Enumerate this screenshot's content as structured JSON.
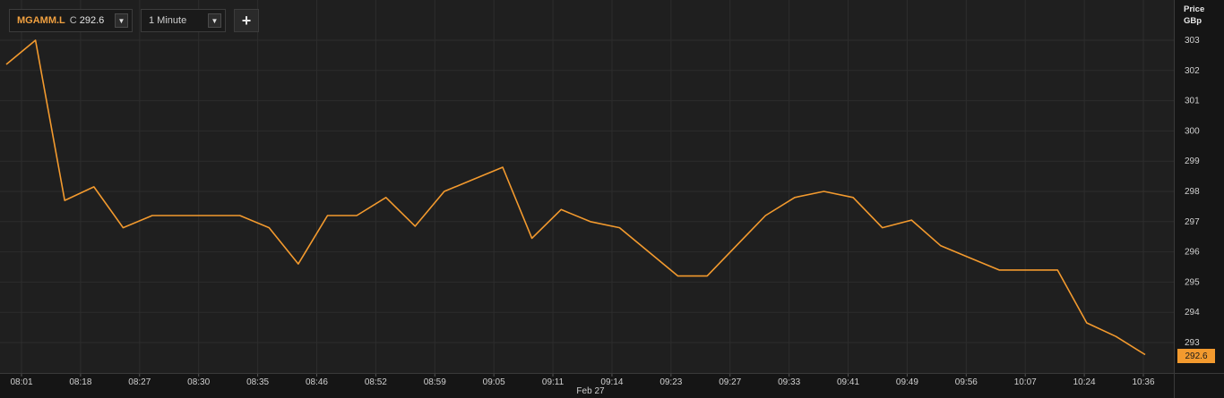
{
  "toolbar": {
    "symbol": "MGAMM.L",
    "close_prefix": "C",
    "close_value": "292.6",
    "symbol_dropdown_icon": "triangle-down-icon",
    "interval": "1 Minute",
    "interval_dropdown_icon": "triangle-down-icon",
    "add_label": "+"
  },
  "axis": {
    "price_title": "Price",
    "currency": "GBp",
    "last_price_tag": "292.6",
    "date_label": "Feb 27"
  },
  "colors": {
    "line": "#f39a2e",
    "grid": "#2d2d2d",
    "plot_bg": "#1f1f1f",
    "page_bg": "#151515",
    "accent": "#f0a040"
  },
  "chart_data": {
    "type": "line",
    "title": "",
    "xlabel": "Feb 27",
    "ylabel": "Price GBp",
    "ylim": [
      292.5,
      303.5
    ],
    "grid": true,
    "y_ticks": [
      293,
      294,
      295,
      296,
      297,
      298,
      299,
      300,
      301,
      302,
      303
    ],
    "x_tick_labels": [
      "08:01",
      "08:18",
      "08:27",
      "08:30",
      "08:35",
      "08:46",
      "08:52",
      "08:59",
      "09:05",
      "09:11",
      "09:14",
      "09:23",
      "09:27",
      "09:33",
      "09:41",
      "09:49",
      "09:56",
      "10:07",
      "10:24",
      "10:36"
    ],
    "series": [
      {
        "values": [
          302.2,
          303.0,
          297.7,
          298.15,
          296.8,
          297.2,
          297.2,
          297.2,
          297.2,
          296.8,
          295.6,
          297.2,
          297.2,
          297.8,
          296.85,
          298.0,
          298.4,
          298.8,
          296.45,
          297.4,
          297.0,
          296.8,
          296.0,
          295.2,
          295.2,
          296.2,
          297.2,
          297.8,
          298.0,
          297.8,
          296.8,
          297.05,
          296.2,
          295.8,
          295.4,
          295.4,
          295.4,
          293.65,
          293.2,
          292.6
        ]
      }
    ]
  }
}
